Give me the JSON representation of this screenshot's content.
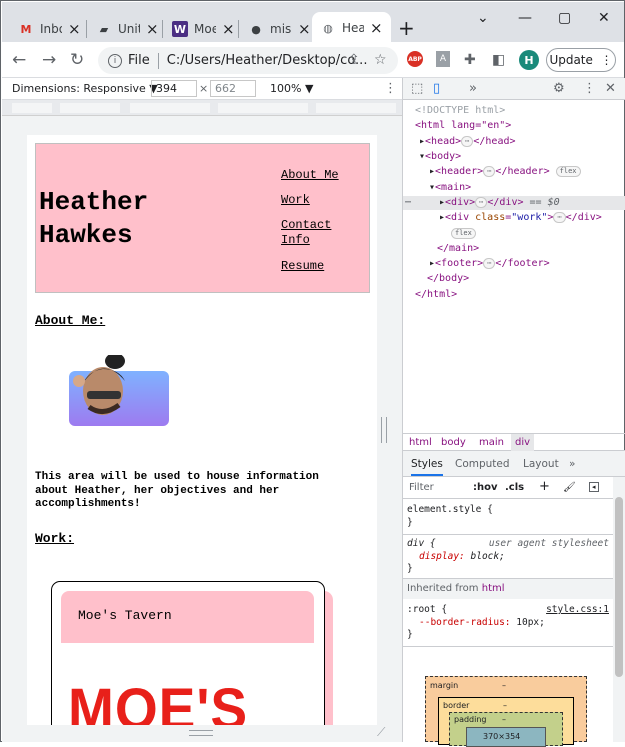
{
  "tabs": [
    {
      "title": "Inbo",
      "icon": "gmail-icon",
      "glyph": "M",
      "color": "#d93025"
    },
    {
      "title": "Unit",
      "icon": "book-icon",
      "glyph": "▰",
      "color": "#202124"
    },
    {
      "title": "Moe",
      "icon": "w-logo-icon",
      "glyph": "W",
      "color": "#4b2e83"
    },
    {
      "title": "mis",
      "icon": "github-icon",
      "glyph": "●",
      "color": "#202124"
    },
    {
      "title": "Hea",
      "icon": "globe-icon",
      "glyph": "◍",
      "color": "#5f6368"
    }
  ],
  "toolbar": {
    "address_prefix": "File",
    "address": "C:/Users/Heather/Desktop/co...",
    "profile_initial": "H",
    "update_label": "Update"
  },
  "device": {
    "dimensions_label": "Dimensions: Responsive ▼",
    "width": "394",
    "height": "662",
    "zoom": "100% ▼"
  },
  "site": {
    "name": "Heather Hawkes",
    "nav": [
      "About Me",
      "Work",
      "Contact Info",
      "Resume"
    ],
    "about_heading": "About Me:",
    "about_text": "This area will be used to house information about Heather, her objectives and her accomplishments!",
    "work_heading": "Work:",
    "card_title": "Moe's Tavern",
    "card_logo": "MOE'S"
  },
  "devtools": {
    "tree": {
      "doctype": "<!DOCTYPE html>",
      "html_open": "<html lang=\"en\">",
      "head": "<head>",
      "head_close": "</head>",
      "body": "<body>",
      "header": "<header>",
      "header_close": "</header>",
      "main": "<main>",
      "div": "<div>",
      "div_close": "</div>",
      "div_marker": "== $0",
      "div_work": "<div class=\"work\">",
      "main_close": "</main>",
      "footer": "<footer>",
      "footer_close": "</footer>",
      "body_close": "</body>",
      "html_close": "</html>",
      "pill_flex": "flex",
      "ellipsis": "⋯"
    },
    "breadcrumbs": [
      "html",
      "body",
      "main",
      "div"
    ],
    "style_tabs": [
      "Styles",
      "Computed",
      "Layout",
      "»"
    ],
    "filter_placeholder": "Filter",
    "hov": ":hov",
    "cls": ".cls",
    "rules": {
      "element_style": "element.style {",
      "close": "}",
      "div_selector": "div {",
      "ua_label": "user agent stylesheet",
      "display_prop": "display:",
      "display_val": "block;",
      "inherited_label": "Inherited from",
      "inherited_tag": "html",
      "root_selector": ":root {",
      "root_source": "style.css:1",
      "radius_prop": "--border-radius:",
      "radius_val": "10px;"
    },
    "boxmodel": {
      "margin": "margin",
      "border": "border",
      "padding": "padding",
      "dash": "–",
      "content": "370×354"
    }
  }
}
